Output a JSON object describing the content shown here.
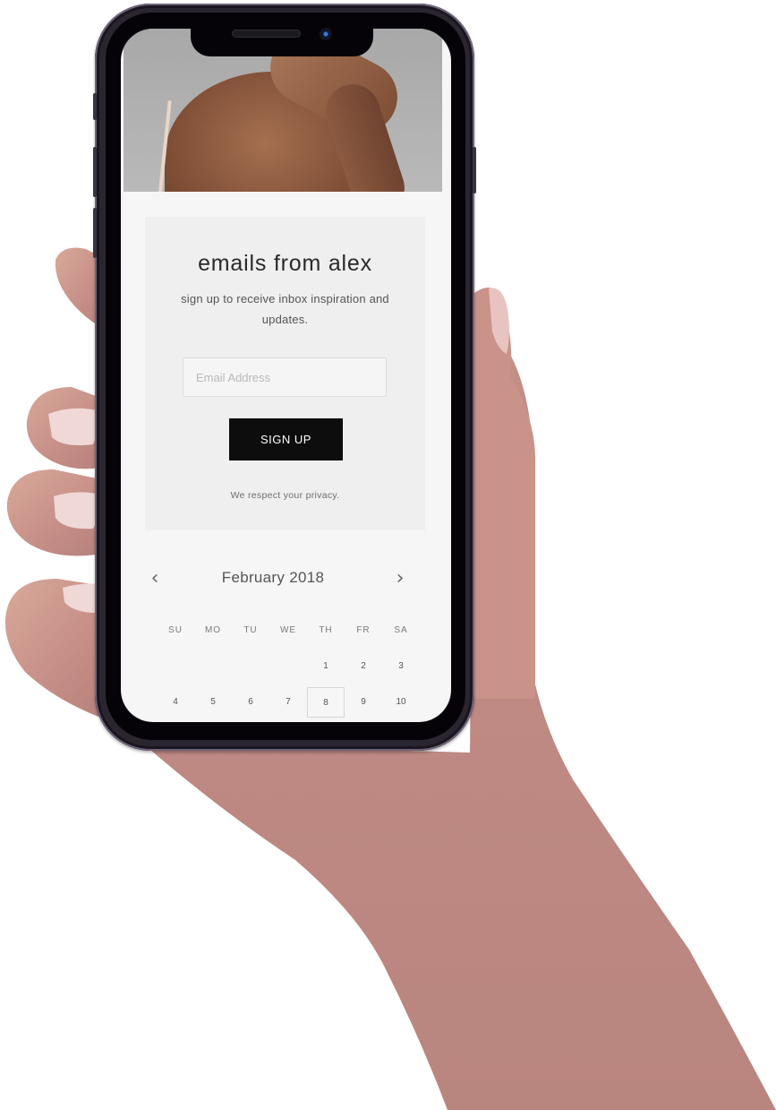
{
  "signup": {
    "title": "emails from alex",
    "subtitle": "sign up to receive inbox inspiration and updates.",
    "email_placeholder": "Email Address",
    "email_value": "",
    "button_label": "SIGN UP",
    "privacy_note": "We respect your privacy."
  },
  "calendar": {
    "month_label": "February 2018",
    "prev_icon": "chevron-left-icon",
    "next_icon": "chevron-right-icon",
    "prev_glyph": "‹",
    "next_glyph": "›",
    "weekdays": [
      "SU",
      "MO",
      "TU",
      "WE",
      "TH",
      "FR",
      "SA"
    ],
    "weeks": [
      [
        "",
        "",
        "",
        "",
        "1",
        "2",
        "3"
      ],
      [
        "4",
        "5",
        "6",
        "7",
        "8",
        "9",
        "10"
      ]
    ],
    "selected_date": "8"
  },
  "colors": {
    "button_bg": "#0d0d0d",
    "card_bg": "#efefef",
    "screen_bg": "#f6f6f6"
  }
}
